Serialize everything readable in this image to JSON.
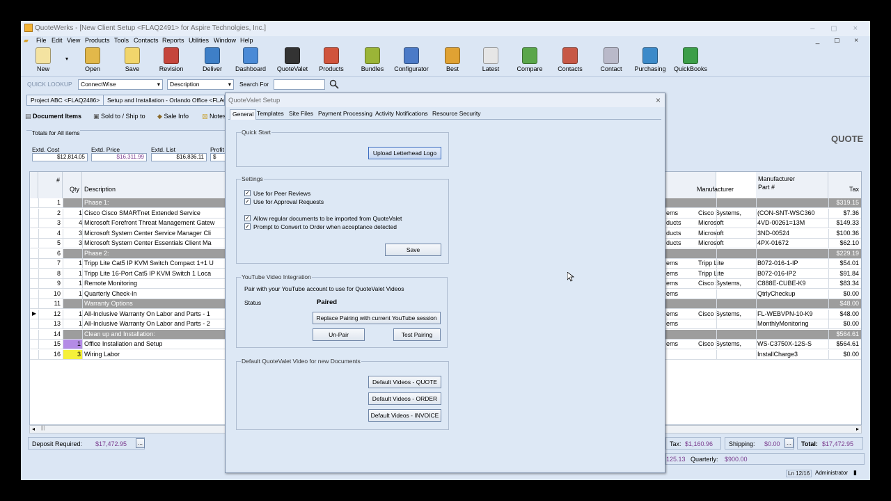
{
  "window": {
    "title": "QuoteWerks - [New Client Setup <FLAQ2491> for Aspire Technolgies, Inc.]",
    "controls": "–  ◻  ×",
    "mdi_controls": "_  ◻  ×"
  },
  "menu": [
    "File",
    "Edit",
    "View",
    "Products",
    "Tools",
    "Contacts",
    "Reports",
    "Utilities",
    "Window",
    "Help"
  ],
  "toolbar": [
    {
      "label": "New",
      "color": "#f4e3a1"
    },
    {
      "label": "Open",
      "color": "#e2b84a"
    },
    {
      "label": "Save",
      "color": "#f1d56b"
    },
    {
      "label": "Revision",
      "color": "#c5453c"
    },
    {
      "label": "Deliver",
      "color": "#3e7fc7"
    },
    {
      "label": "Dashboard",
      "color": "#4a8ad6"
    },
    {
      "label": "QuoteValet",
      "color": "#333333"
    },
    {
      "label": "Products",
      "color": "#d0543c"
    },
    {
      "label": "Bundles",
      "color": "#9bb537"
    },
    {
      "label": "Configurator",
      "color": "#4b7ac7"
    },
    {
      "label": "Best",
      "color": "#e0a233"
    },
    {
      "label": "Latest",
      "color": "#e6e6e6"
    },
    {
      "label": "Compare",
      "color": "#5aa64a"
    },
    {
      "label": "Contacts",
      "color": "#c75846"
    },
    {
      "label": "Contact",
      "color": "#b9b9c9"
    },
    {
      "label": "Purchasing",
      "color": "#3c8ac9"
    },
    {
      "label": "QuickBooks",
      "color": "#3c9e49"
    }
  ],
  "lookup": {
    "label": "QUICK LOOKUP",
    "source": "ConnectWise",
    "field": "Description",
    "search_label": "Search For",
    "search_value": ""
  },
  "doc_tabs": [
    "Project ABC <FLAQ2486>",
    "Setup and Installation - Orlando Office <FLAQ2"
  ],
  "sub_tabs": [
    "Document Items",
    "Sold to / Ship to",
    "Sale Info",
    "Notes"
  ],
  "totals": {
    "heading": "Totals for All items",
    "labels": [
      "Extd. Cost",
      "Extd. Price",
      "Extd. List",
      "Profit"
    ],
    "values": [
      "$12,814.05",
      "$16,311.99",
      "$16,836.11",
      "$"
    ]
  },
  "doc_type": "QUOTE",
  "grid": {
    "headers": {
      "num": "#",
      "qty": "Qty",
      "desc": "Description",
      "mfr": "Manufacturer",
      "part": "Manufacturer\nPart #",
      "tax": "Tax"
    },
    "rows": [
      {
        "n": "1",
        "q": "",
        "d": "Phase 1:",
        "cat": "",
        "m": "",
        "p": "",
        "t": "$319.15",
        "phase": true
      },
      {
        "n": "2",
        "q": "1",
        "d": "Cisco Cisco SMARTnet Extended Service",
        "cat": "ems",
        "m": "Cisco Systems,",
        "p": "(CON-SNT-WSC360",
        "t": "$7.36"
      },
      {
        "n": "3",
        "q": "4",
        "d": "Microsoft Forefront Threat Management Gatew",
        "cat": "ducts",
        "m": "Microsoft",
        "p": "4VD-00261=13M",
        "t": "$149.33"
      },
      {
        "n": "4",
        "q": "3",
        "d": "Microsoft System Center Service Manager Cli",
        "cat": "ducts",
        "m": "Microsoft",
        "p": "3ND-00524",
        "t": "$100.36"
      },
      {
        "n": "5",
        "q": "3",
        "d": "Microsoft System Center Essentials Client Ma",
        "cat": "ducts",
        "m": "Microsoft",
        "p": "4PX-01672",
        "t": "$62.10"
      },
      {
        "n": "6",
        "q": "",
        "d": "Phase 2:",
        "cat": "",
        "m": "",
        "p": "",
        "t": "$229.19",
        "phase": true
      },
      {
        "n": "7",
        "q": "1",
        "d": "Tripp Lite Cat5 IP KVM Switch Compact 1+1 U",
        "cat": "ems",
        "m": "Tripp Lite",
        "p": "B072-016-1-IP",
        "t": "$54.01"
      },
      {
        "n": "8",
        "q": "1",
        "d": "Tripp Lite 16-Port Cat5 IP KVM Switch 1 Loca",
        "cat": "ems",
        "m": "Tripp Lite",
        "p": "B072-016-IP2",
        "t": "$91.84"
      },
      {
        "n": "9",
        "q": "1",
        "d": "Remote Monitoring",
        "cat": "ems",
        "m": "Cisco Systems,",
        "p": "C888E-CUBE-K9",
        "t": "$83.34"
      },
      {
        "n": "10",
        "q": "1",
        "d": "Quarterly Check-In",
        "cat": "ems",
        "m": "",
        "p": "QtrlyCheckup",
        "t": "$0.00"
      },
      {
        "n": "11",
        "q": "",
        "d": "Warranty Options",
        "cat": "",
        "m": "",
        "p": "",
        "t": "$48.00",
        "phase": true
      },
      {
        "n": "12",
        "q": "1",
        "d": "All-Inclusive Warranty On Labor and Parts - 1",
        "cat": "ems",
        "m": "Cisco Systems,",
        "p": "FL-WEBVPN-10-K9",
        "t": "$48.00",
        "current": true
      },
      {
        "n": "13",
        "q": "1",
        "d": "All-Inclusive Warranty On Labor and Parts - 2",
        "cat": "ems",
        "m": "",
        "p": "MonthlyMonitoring",
        "t": "$0.00"
      },
      {
        "n": "14",
        "q": "",
        "d": "Clean up and Installation:",
        "cat": "",
        "m": "",
        "p": "",
        "t": "$564.61",
        "phase": true
      },
      {
        "n": "15",
        "q": "1",
        "d": "Office Installation and Setup",
        "cat": "ems",
        "m": "Cisco Systems,",
        "p": "WS-C3750X-12S-S",
        "t": "$564.61",
        "qcolor": "#b48be6"
      },
      {
        "n": "16",
        "q": "3",
        "d": "Wiring Labor",
        "cat": "",
        "m": "",
        "p": "InstallCharge3",
        "t": "$0.00",
        "qcolor": "#f5f03a"
      }
    ]
  },
  "footer": {
    "deposit_label": "Deposit Required:",
    "deposit_value": "$17,472.95",
    "tax_label": "Tax:",
    "tax_value": "$1,160.96",
    "shipping_label": "Shipping:",
    "shipping_value": "$0.00",
    "total_label": "Total:",
    "total_value": "$17,472.95",
    "recurring_value": "125.13",
    "quarterly_label": "Quarterly:",
    "quarterly_value": "$900.00",
    "ellipsis": "..."
  },
  "status": {
    "line": "Ln 12/16",
    "user": "Administrator"
  },
  "dialog": {
    "title": "QuoteValet Setup",
    "close": "×",
    "tabs": [
      "General",
      "Templates",
      "Site Files",
      "Payment Processing",
      "Activity Notifications",
      "Resource Security"
    ],
    "quick_start": {
      "label": "Quick Start",
      "upload_button": "Upload Letterhead Logo"
    },
    "settings": {
      "label": "Settings",
      "checks": [
        "Use for Peer Reviews",
        "Use for Approval Requests",
        "Allow regular documents to be imported from QuoteValet",
        "Prompt to Convert to Order when acceptance detected"
      ],
      "check_mark": "✓",
      "save_button": "Save"
    },
    "youtube": {
      "label": "YouTube Video Integration",
      "description": "Pair with your YouTube account to use for QuoteValet Videos",
      "status_label": "Status",
      "status_value": "Paired",
      "replace_button": "Replace Pairing with current YouTube session",
      "unpair_button": "Un-Pair",
      "test_button": "Test Pairing"
    },
    "default_video": {
      "label": "Default QuoteValet Video for new Documents",
      "buttons": [
        "Default Videos - QUOTE",
        "Default Videos - ORDER",
        "Default Videos - INVOICE"
      ]
    }
  }
}
